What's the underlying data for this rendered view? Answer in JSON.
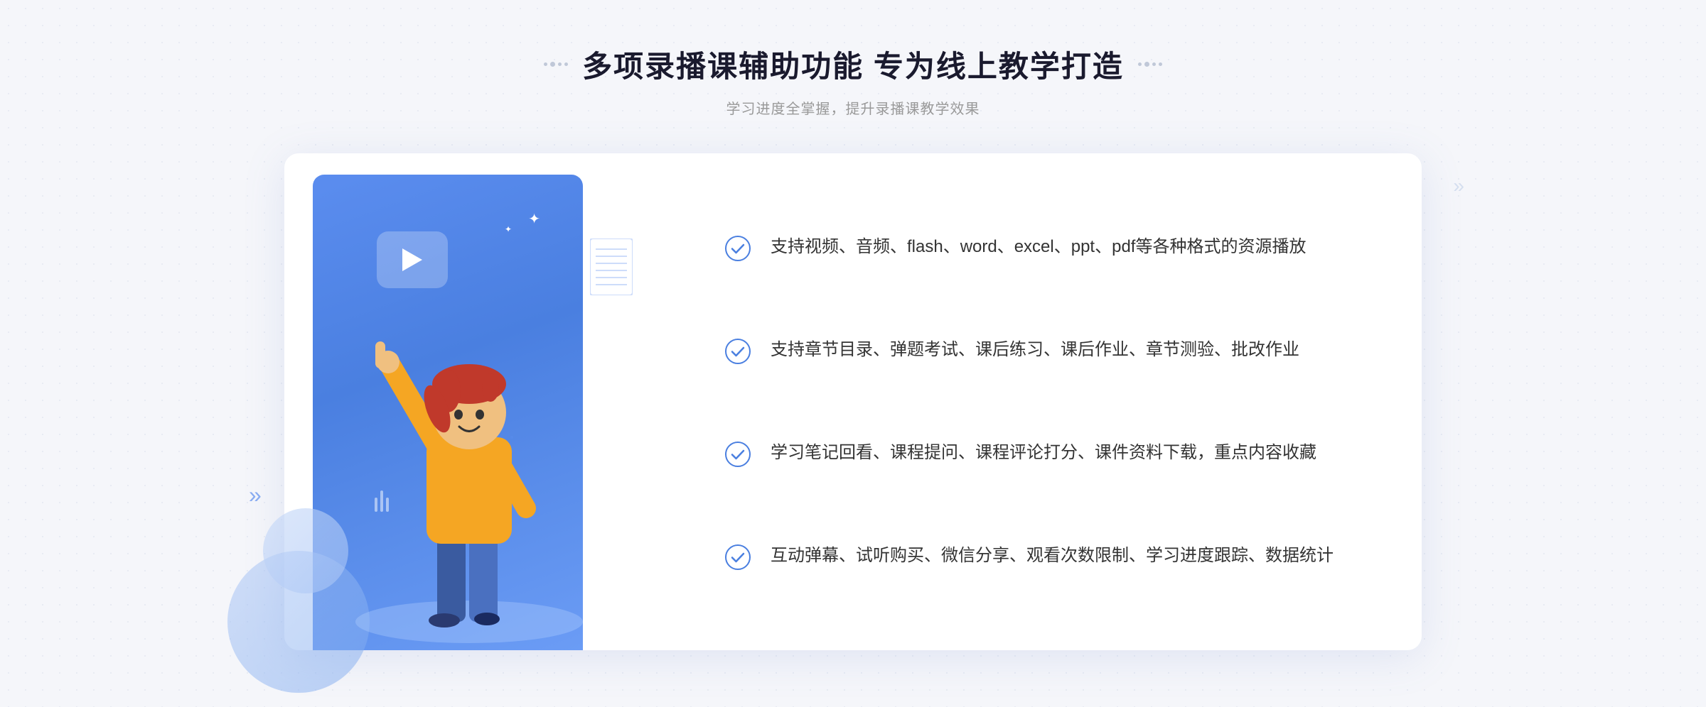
{
  "header": {
    "title": "多项录播课辅助功能 专为线上教学打造",
    "subtitle": "学习进度全掌握，提升录播课教学效果",
    "deco_left": "decorative-dots-left",
    "deco_right": "decorative-dots-right"
  },
  "features": [
    {
      "id": "feature-1",
      "text": "支持视频、音频、flash、word、excel、ppt、pdf等各种格式的资源播放"
    },
    {
      "id": "feature-2",
      "text": "支持章节目录、弹题考试、课后练习、课后作业、章节测验、批改作业"
    },
    {
      "id": "feature-3",
      "text": "学习笔记回看、课程提问、课程评论打分、课件资料下载，重点内容收藏"
    },
    {
      "id": "feature-4",
      "text": "互动弹幕、试听购买、微信分享、观看次数限制、学习进度跟踪、数据统计"
    }
  ],
  "colors": {
    "blue_primary": "#4a7fe0",
    "blue_light": "#6b9cf5",
    "text_dark": "#1a1a2e",
    "text_gray": "#999999",
    "text_body": "#333333",
    "check_color": "#4a7fe0",
    "bg": "#f5f6fa"
  }
}
